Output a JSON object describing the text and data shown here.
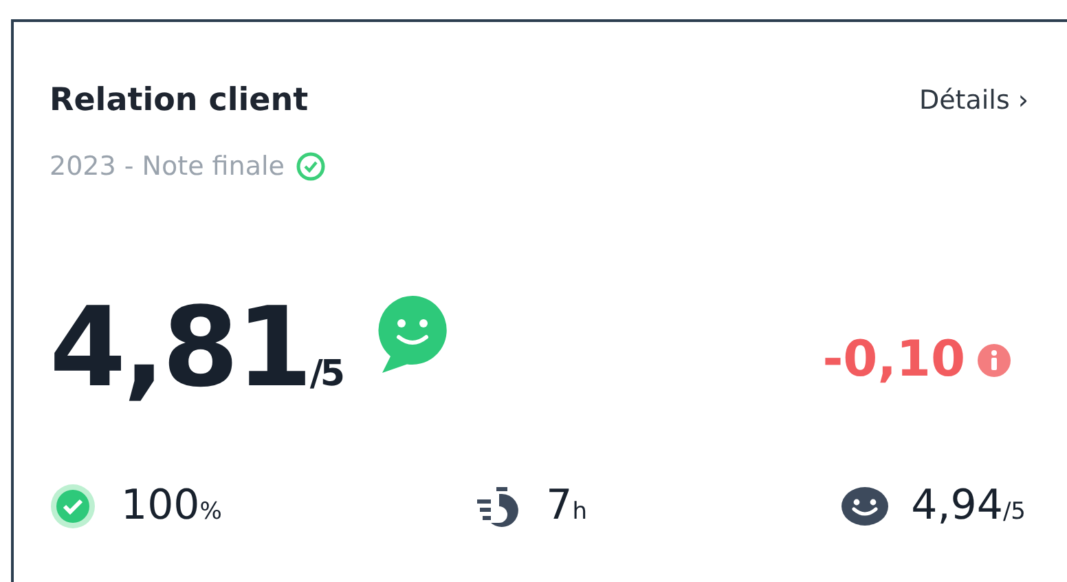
{
  "card": {
    "title": "Relation client",
    "details_link": "Détails",
    "chevron": "›",
    "subtitle": "2023 - Note finale",
    "score": {
      "value": "4,81",
      "scale": "/5"
    },
    "delta": "-0,10",
    "stats": [
      {
        "kind": "check",
        "value": "100",
        "unit": "%"
      },
      {
        "kind": "timer",
        "value": "7",
        "unit": "h"
      },
      {
        "kind": "smiley",
        "value": "4,94",
        "unit": "/5"
      }
    ]
  }
}
